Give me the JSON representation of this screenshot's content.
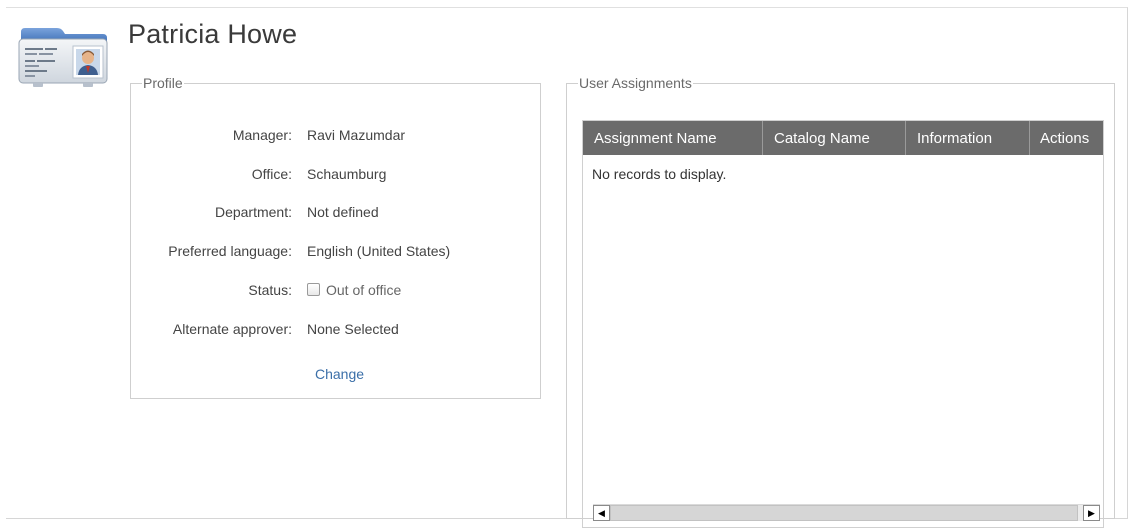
{
  "user": {
    "name": "Patricia Howe"
  },
  "profile": {
    "legend": "Profile",
    "rows": [
      {
        "label": "Manager:",
        "value": "Ravi Mazumdar"
      },
      {
        "label": "Office:",
        "value": "Schaumburg"
      },
      {
        "label": "Department:",
        "value": "Not defined"
      },
      {
        "label": "Preferred language:",
        "value": "English (United States)"
      },
      {
        "label": "Status:",
        "value": "Out of office",
        "checked": false
      },
      {
        "label": "Alternate approver:",
        "value": "None Selected"
      }
    ],
    "change_link": "Change"
  },
  "assignments": {
    "legend": "User Assignments",
    "columns": [
      "Assignment Name",
      "Catalog Name",
      "Information",
      "Actions"
    ],
    "empty_text": "No records to display.",
    "scroll_left_icon": "arrow-left-icon",
    "scroll_right_icon": "arrow-right-icon"
  },
  "icons": {
    "avatar": "id-card-icon"
  },
  "colors": {
    "header_bg": "#6b6b6b",
    "link": "#3b6fa8",
    "card_blue": "#5b86c6"
  }
}
